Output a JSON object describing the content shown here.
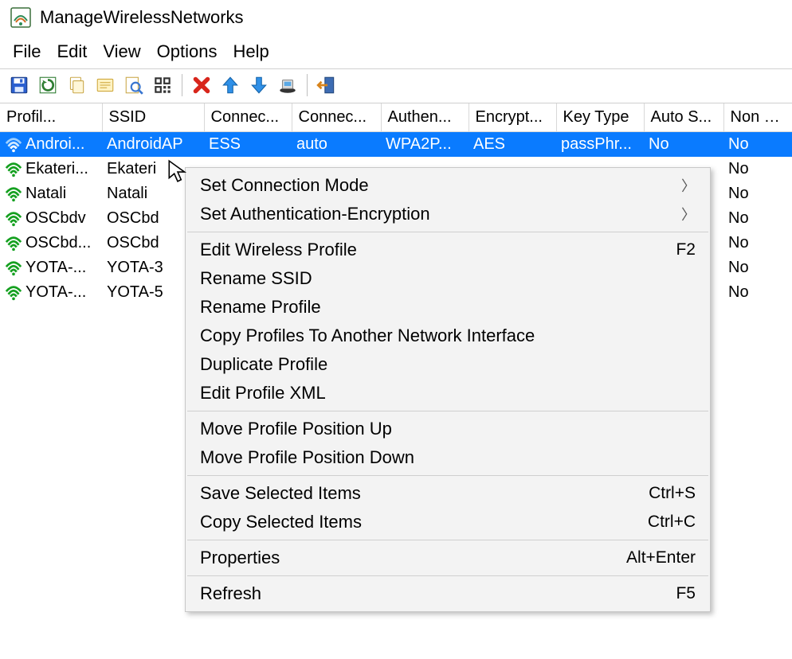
{
  "title": "ManageWirelessNetworks",
  "menu": {
    "file": "File",
    "edit": "Edit",
    "view": "View",
    "options": "Options",
    "help": "Help"
  },
  "columns": {
    "profile": "Profil...",
    "ssid": "SSID",
    "connect1": "Connec...",
    "connect2": "Connec...",
    "authen": "Authen...",
    "encrypt": "Encrypt...",
    "keytype": "Key Type",
    "autos": "Auto S...",
    "nonb": "Non B..."
  },
  "rows": [
    {
      "profile": "Androi...",
      "ssid": "AndroidAP",
      "c1": "ESS",
      "c2": "auto",
      "auth": "WPA2P...",
      "enc": "AES",
      "kt": "passPhr...",
      "as": "No",
      "nb": "No",
      "selected": true
    },
    {
      "profile": "Ekateri...",
      "ssid": "Ekateri",
      "c1": "",
      "c2": "",
      "auth": "",
      "enc": "",
      "kt": "",
      "as": "",
      "nb": "No",
      "selected": false
    },
    {
      "profile": "Natali",
      "ssid": "Natali",
      "c1": "",
      "c2": "",
      "auth": "",
      "enc": "",
      "kt": "",
      "as": "",
      "nb": "No",
      "selected": false
    },
    {
      "profile": "OSCbdv",
      "ssid": "OSCbd",
      "c1": "",
      "c2": "",
      "auth": "",
      "enc": "",
      "kt": "",
      "as": "",
      "nb": "No",
      "selected": false
    },
    {
      "profile": "OSCbd...",
      "ssid": "OSCbd",
      "c1": "",
      "c2": "",
      "auth": "",
      "enc": "",
      "kt": "",
      "as": "",
      "nb": "No",
      "selected": false
    },
    {
      "profile": "YOTA-...",
      "ssid": "YOTA-3",
      "c1": "",
      "c2": "",
      "auth": "",
      "enc": "",
      "kt": "",
      "as": "",
      "nb": "No",
      "selected": false
    },
    {
      "profile": "YOTA-...",
      "ssid": "YOTA-5",
      "c1": "",
      "c2": "",
      "auth": "",
      "enc": "",
      "kt": "",
      "as": "",
      "nb": "No",
      "selected": false
    }
  ],
  "contextmenu": {
    "set_connection_mode": "Set Connection Mode",
    "set_auth_encryption": "Set Authentication-Encryption",
    "edit_wireless_profile": "Edit Wireless Profile",
    "edit_wireless_profile_sc": "F2",
    "rename_ssid": "Rename SSID",
    "rename_profile": "Rename Profile",
    "copy_profiles_another": "Copy Profiles To Another Network Interface",
    "duplicate_profile": "Duplicate Profile",
    "edit_profile_xml": "Edit Profile XML",
    "move_up": "Move Profile Position Up",
    "move_down": "Move Profile Position Down",
    "save_selected": "Save Selected Items",
    "save_selected_sc": "Ctrl+S",
    "copy_selected": "Copy Selected Items",
    "copy_selected_sc": "Ctrl+C",
    "properties": "Properties",
    "properties_sc": "Alt+Enter",
    "refresh": "Refresh",
    "refresh_sc": "F5"
  }
}
